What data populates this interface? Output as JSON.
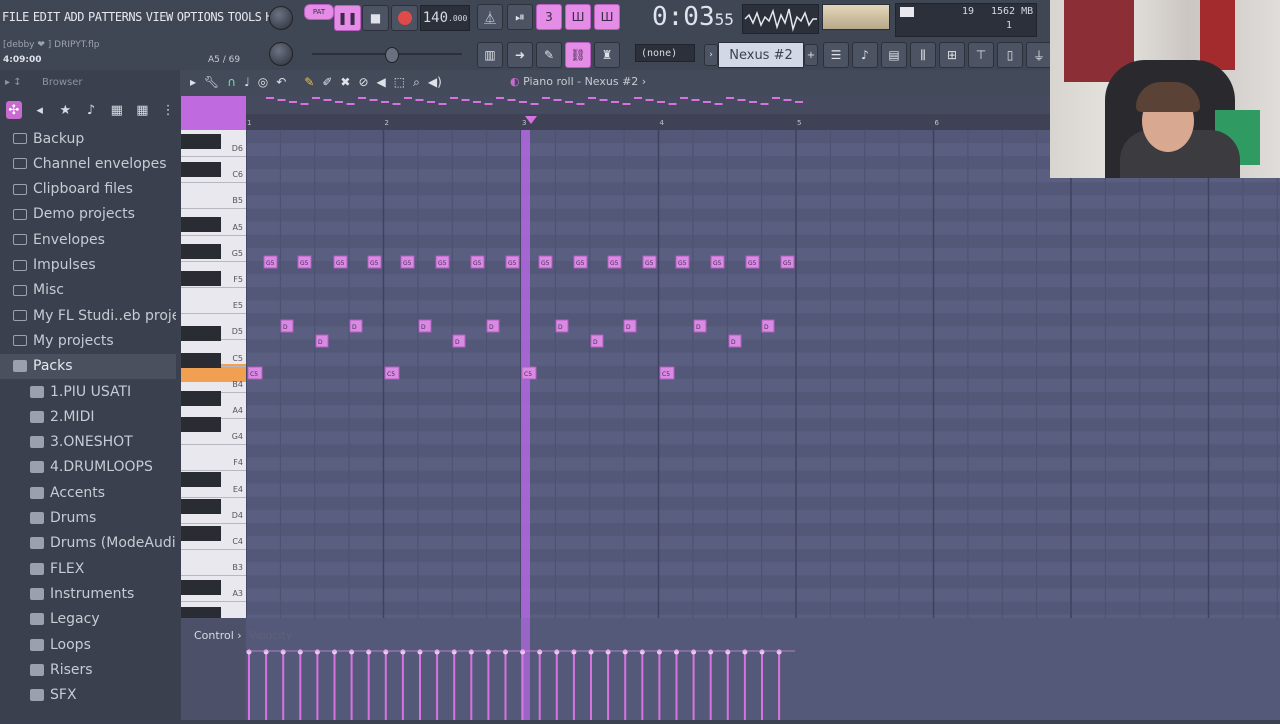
{
  "menu": [
    "FILE",
    "EDIT",
    "ADD",
    "PATTERNS",
    "VIEW",
    "OPTIONS",
    "TOOLS",
    "HELP"
  ],
  "transport": {
    "pat_label": "PAT",
    "tempo": "140",
    "tempo_decimals": ".000",
    "time_main": "0:03",
    "time_sub": "55",
    "memory": "1562 MB",
    "cpu_top": "19",
    "cpu_bottom": "1"
  },
  "project": {
    "user": "[debby ❤",
    "file": "] DRIPYT.flp",
    "time": "4:09:00",
    "note_pos": "A5 / 69"
  },
  "toolbar2": {
    "none_select": "(none)",
    "channel_select": "Nexus #2"
  },
  "browser": {
    "title": "Browser",
    "items": [
      {
        "label": "Backup",
        "type": "folder"
      },
      {
        "label": "Channel envelopes",
        "type": "folder"
      },
      {
        "label": "Clipboard files",
        "type": "folder"
      },
      {
        "label": "Demo projects",
        "type": "folder"
      },
      {
        "label": "Envelopes",
        "type": "folder"
      },
      {
        "label": "Impulses",
        "type": "folder"
      },
      {
        "label": "Misc",
        "type": "folder"
      },
      {
        "label": "My FL Studi..eb projects",
        "type": "folder"
      },
      {
        "label": "My projects",
        "type": "folder"
      },
      {
        "label": "Packs",
        "type": "pack"
      },
      {
        "label": "1.PIU USATI",
        "type": "child"
      },
      {
        "label": "2.MIDI",
        "type": "child"
      },
      {
        "label": "3.ONESHOT",
        "type": "child"
      },
      {
        "label": "4.DRUMLOOPS",
        "type": "child"
      },
      {
        "label": "Accents",
        "type": "child"
      },
      {
        "label": "Drums",
        "type": "child"
      },
      {
        "label": "Drums (ModeAudio)",
        "type": "child"
      },
      {
        "label": "FLEX",
        "type": "child"
      },
      {
        "label": "Instruments",
        "type": "child"
      },
      {
        "label": "Legacy",
        "type": "child"
      },
      {
        "label": "Loops",
        "type": "child"
      },
      {
        "label": "Risers",
        "type": "child"
      },
      {
        "label": "SFX",
        "type": "child"
      }
    ]
  },
  "piano_roll": {
    "title": "Piano roll - Nexus #2",
    "bars": [
      "1",
      "2",
      "3",
      "4",
      "5",
      "6"
    ],
    "key_labels": [
      "D6",
      "C6",
      "B5",
      "A5",
      "G5",
      "F5",
      "E5",
      "D5",
      "C5",
      "B4",
      "A4",
      "G4",
      "F4",
      "E4",
      "D4",
      "C4",
      "B3",
      "A3"
    ],
    "control_label": "Control",
    "control_mode": "Velocity",
    "note_label_g": "G5",
    "note_label_d": "D",
    "note_label_c": "C5"
  },
  "colors": {
    "accent": "#d872e0",
    "grid_bg": "#585c7d",
    "note": "#d98be4",
    "playhead": "#b168e0",
    "selected_key": "#f0a050"
  }
}
